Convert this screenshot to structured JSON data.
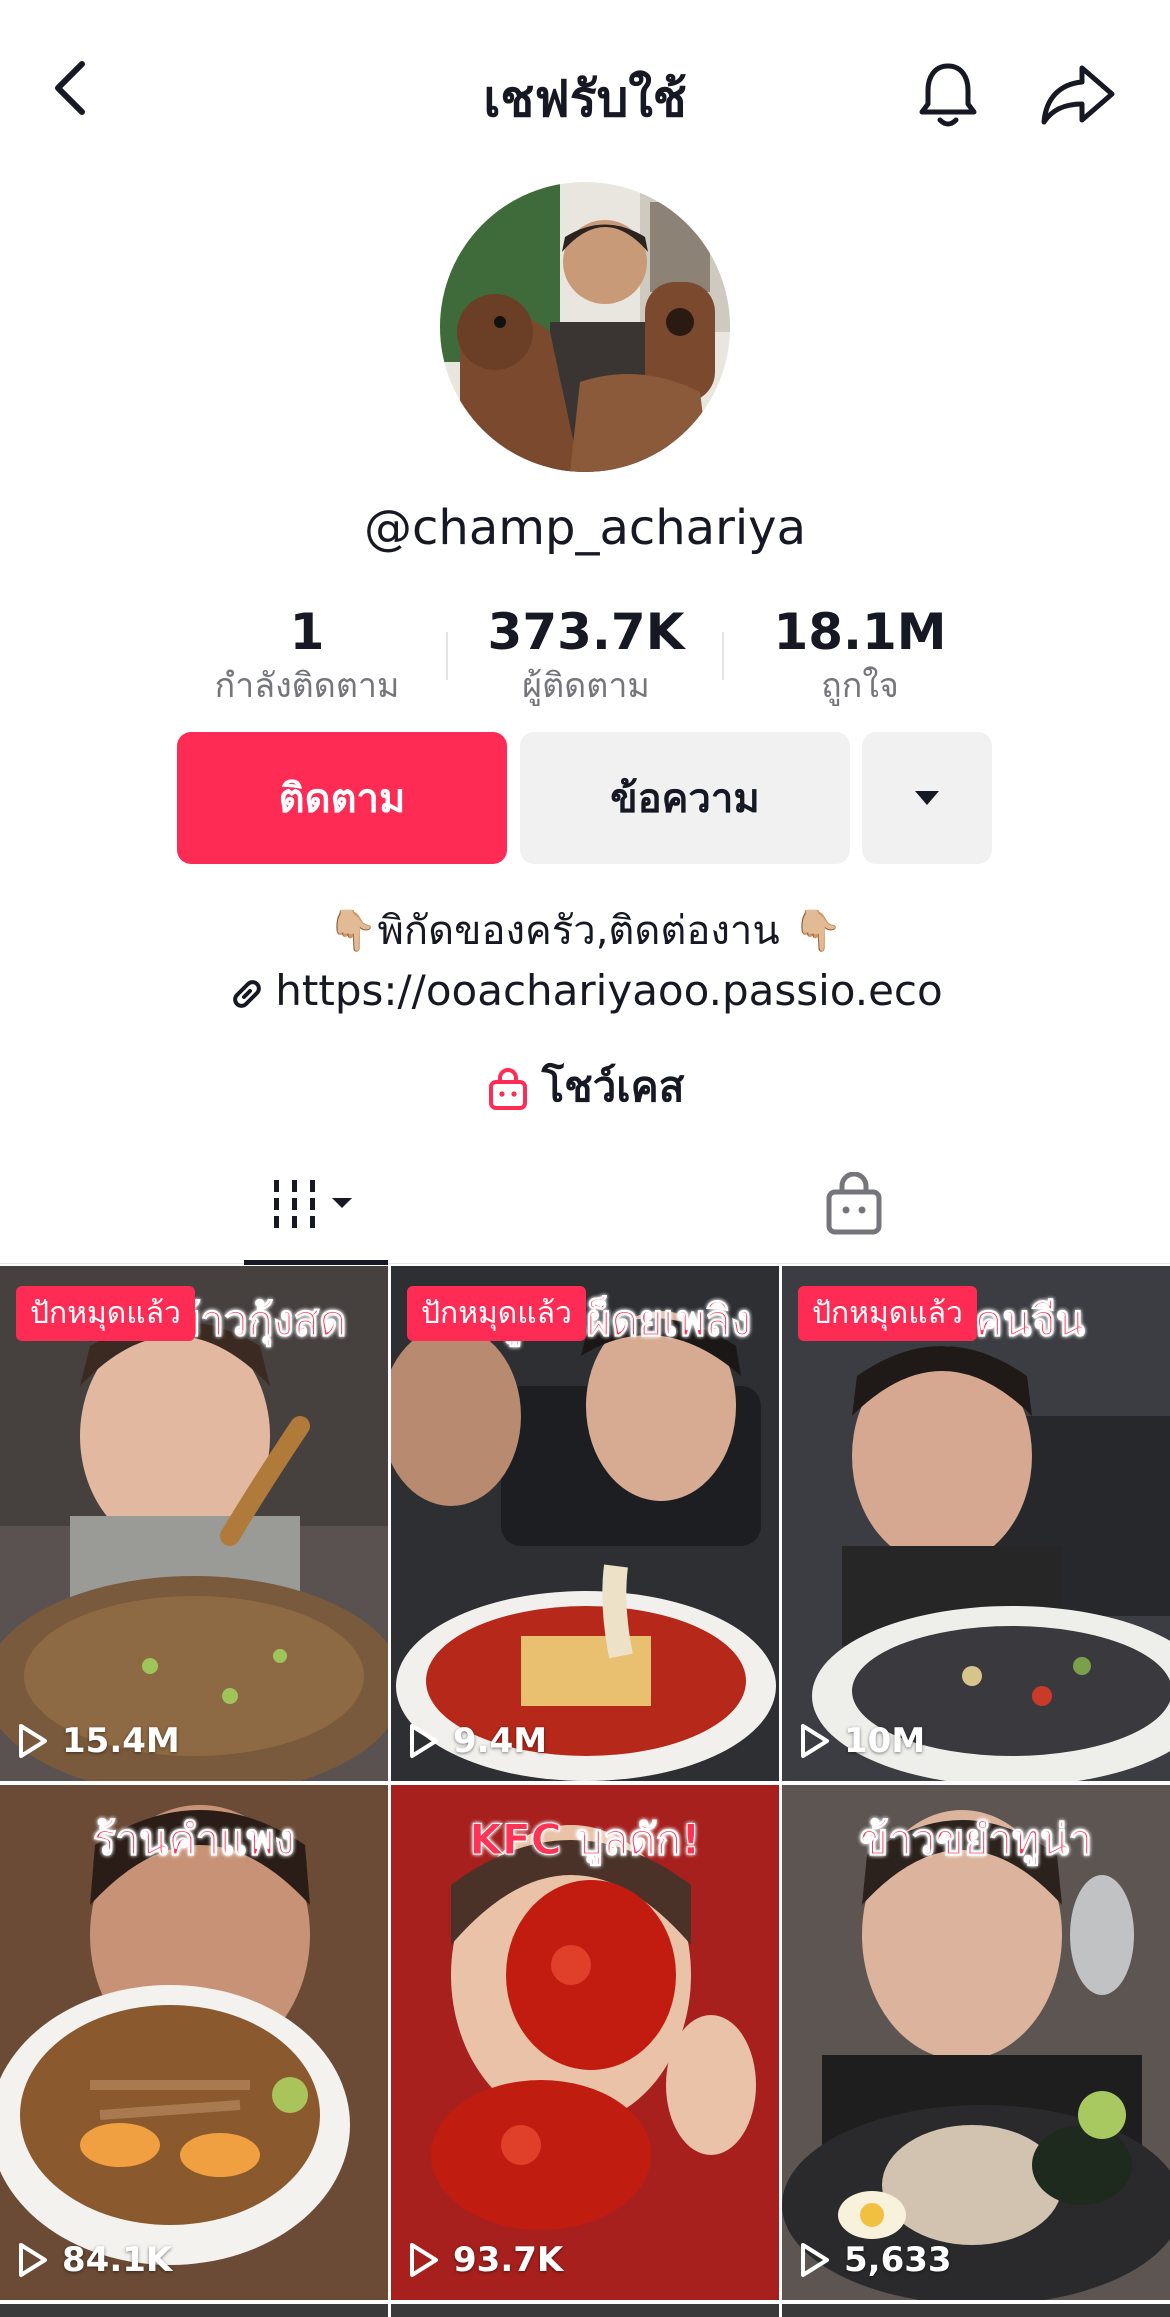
{
  "header": {
    "title": "เชฟรับใช้",
    "back_icon": "chevron-left-icon",
    "bell_icon": "bell-icon",
    "share_icon": "share-arrow-icon"
  },
  "profile": {
    "username": "@champ_achariya",
    "stats": [
      {
        "value": "1",
        "label": "กำลังติดตาม"
      },
      {
        "value": "373.7K",
        "label": "ผู้ติดตาม"
      },
      {
        "value": "18.1M",
        "label": "ถูกใจ"
      }
    ],
    "buttons": {
      "follow": "ติดตาม",
      "message": "ข้อความ"
    },
    "bio": "👇🏼พิกัดของครัว,ติดต่องาน 👇🏼",
    "link": "https://ooachariyaoo.passio.eco",
    "showcase": "โชว์เคส"
  },
  "colors": {
    "accent": "#fe2c55",
    "text_primary": "#161823",
    "text_secondary": "#75767b",
    "button_gray": "#f1f1f2"
  },
  "tabs": {
    "videos_icon": "grid-videos-icon",
    "shop_icon": "shopping-bag-icon"
  },
  "videos": [
    {
      "caption": "ยำแซ่บข้าวกุ้งสด",
      "pinned": "ปักหมุดแล้ว",
      "views": "15.4M"
    },
    {
      "caption": "ยำหมูยอเผ็ดยเพลิง",
      "pinned": "ปักหมุดแล้ว",
      "views": "9.4M"
    },
    {
      "caption": "ผัดหมี่คนจีน",
      "pinned": "ปักหมุดแล้ว",
      "views": "10M"
    },
    {
      "caption": "ร้านคำแพง",
      "pinned": "",
      "views": "84.1K"
    },
    {
      "caption": "KFC บูลดัก!",
      "pinned": "",
      "views": "93.7K"
    },
    {
      "caption": "ข้าวขยำทูน่า",
      "pinned": "",
      "views": "5,633"
    }
  ]
}
